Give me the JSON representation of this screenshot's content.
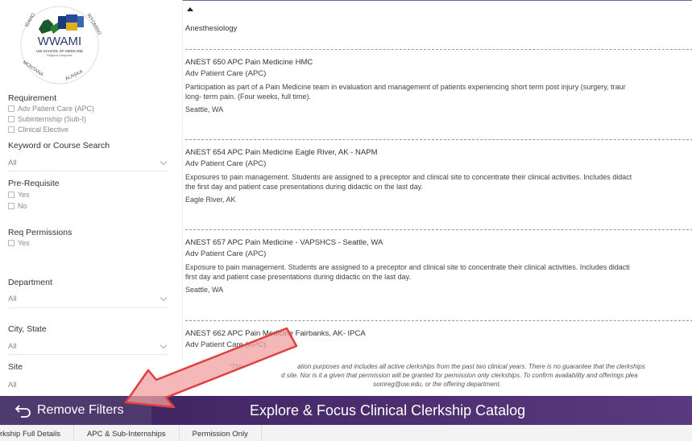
{
  "logo": {
    "title": "WWAMI",
    "subtitle": "UW SCHOOL OF MEDICINE",
    "tag": "Regional Campuses",
    "states": [
      "IDAHO",
      "WYOMING",
      "MONTANA",
      "ALASKA"
    ]
  },
  "sidebar": {
    "requirement_title": "Requirement",
    "requirement_options": [
      "Adv Patient Care (APC)",
      "Subinternship (Sub-I)",
      "Clinical Elective"
    ],
    "keyword_title": "Keyword or Course Search",
    "keyword_value": "All",
    "prereq_title": "Pre-Requisite",
    "prereq_options": [
      "Yes",
      "No"
    ],
    "reqperm_title": "Req Permissions",
    "reqperm_options": [
      "Yes"
    ],
    "department_title": "Department",
    "department_value": "All",
    "city_title": "City, State",
    "city_value": "All",
    "site_title": "Site",
    "site_value": "All"
  },
  "content": {
    "department": "Anesthesiology",
    "courses": [
      {
        "title": "ANEST 650 APC Pain Medicine HMC",
        "requirement": "Adv Patient Care (APC)",
        "desc1": "Participation as part of a Pain Medicine team in evaluation and management of patients experiencing short term post injury (surgery, traur",
        "desc2": "long- term pain. (Four weeks, full time).",
        "location": "Seattle, WA"
      },
      {
        "title": "ANEST 654 APC Pain Medicine Eagle River, AK - NAPM",
        "requirement": "Adv Patient Care (APC)",
        "desc1": "Exposures to pain management. Students are assigned to a preceptor and clinical site to concentrate their clinical activities. Includes didact",
        "desc2": "the first day and patient case presentations during didactic on the last day.",
        "location": "Eagle River, AK"
      },
      {
        "title": "ANEST 657 APC Pain Medicine - VAPSHCS - Seattle, WA",
        "requirement": "Adv Patient Care (APC)",
        "desc1": "Exposure to pain management. Students are assigned to a preceptor and clinical site to concentrate their clinical activities. Includes didacti",
        "desc2": "first day and patient case presentations during didactic on the last day.",
        "location": "Seattle, WA"
      },
      {
        "title": "ANEST 662 APC Pain Medicine Fairbanks, AK- IPCA",
        "requirement": "Adv Patient Care (APC)",
        "desc1": "",
        "desc2": "",
        "location": ""
      }
    ],
    "disclaimer1": "*This                              ation purposes and includes all active clerkships from the past two clinical years. There is no guarantee that the clerkships",
    "disclaimer2": "                         d site. Nor is it a given that permission will be granted for permission only clerkships. To confirm availability and offerings plea",
    "disclaimer3": "somreg@uw.edu,  or the offering department."
  },
  "bottom": {
    "remove_filters": "Remove Filters",
    "app_title": "Explore & Focus Clinical Clerkship Catalog"
  },
  "tabs": [
    "rkship Full Details",
    "APC & Sub-Internships",
    "Permission Only"
  ],
  "colors": {
    "accent": "#7b5da3",
    "bar_dark": "#3a1f5c",
    "button_bg": "#4f3a6e",
    "arrow_fill": "#f2a0a0",
    "arrow_stroke": "#e04040"
  }
}
